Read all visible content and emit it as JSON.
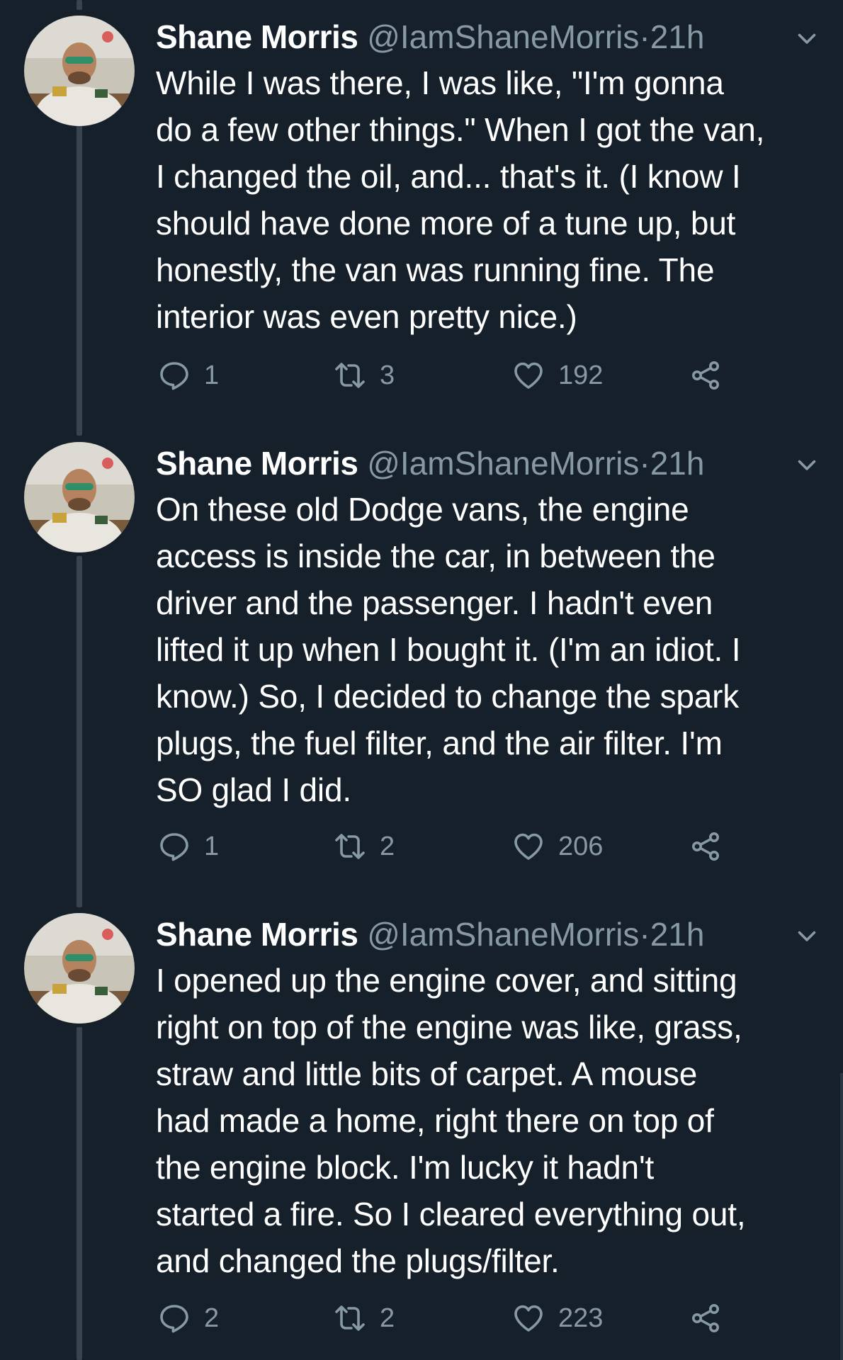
{
  "colors": {
    "background": "#15202b",
    "text": "#ffffff",
    "muted": "#8899a6",
    "thread_line": "#38444d"
  },
  "tweets": [
    {
      "name": "Shane Morris",
      "handle": "@IamShaneMorris",
      "separator": "·",
      "time": "21h",
      "lines": [
        "While I was there, I was like, \"I'm gonna",
        "do a few other things.\" When I got the van,",
        "I changed the oil, and... that's it. (I know I",
        "should have done more of a tune up, but",
        "honestly, the van was running fine. The",
        "interior was even pretty nice.)"
      ],
      "replies": "1",
      "retweets": "3",
      "likes": "192"
    },
    {
      "name": "Shane Morris",
      "handle": "@IamShaneMorris",
      "separator": "·",
      "time": "21h",
      "lines": [
        "On these old Dodge vans, the engine",
        "access is inside the car, in between the",
        "driver and the passenger. I hadn't even",
        "lifted it up when I bought it. (I'm an idiot. I",
        "know.) So, I decided to change the spark",
        "plugs, the fuel filter, and the air filter. I'm",
        "SO glad I did."
      ],
      "replies": "1",
      "retweets": "2",
      "likes": "206"
    },
    {
      "name": "Shane Morris",
      "handle": "@IamShaneMorris",
      "separator": "·",
      "time": "21h",
      "lines": [
        "I opened up the engine cover, and sitting",
        "right on top of the engine was like, grass,",
        "straw and little bits of carpet. A mouse",
        "had made a home, right there on top of",
        "the engine block. I'm lucky it hadn't",
        "started a fire. So I cleared everything out,",
        "and changed the plugs/filter."
      ],
      "replies": "2",
      "retweets": "2",
      "likes": "223"
    }
  ],
  "icons": {
    "reply": "reply-icon",
    "retweet": "retweet-icon",
    "like": "heart-icon",
    "share": "share-icon",
    "menu": "chevron-down-icon",
    "avatar": "avatar"
  }
}
